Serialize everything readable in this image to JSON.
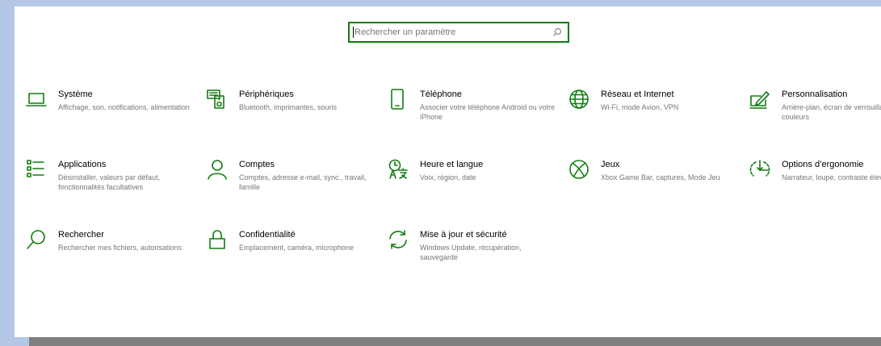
{
  "search": {
    "placeholder": "Rechercher un paramètre"
  },
  "accent": "#107c10",
  "tiles": [
    {
      "title": "Système",
      "desc": "Affichage, son, notifications, alimentation",
      "icon": "laptop-icon"
    },
    {
      "title": "Périphériques",
      "desc": "Bluetooth, imprimantes, souris",
      "icon": "keyboard-speaker-icon"
    },
    {
      "title": "Téléphone",
      "desc": "Associer votre téléphone Android ou votre iPhone",
      "icon": "phone-icon"
    },
    {
      "title": "Réseau et Internet",
      "desc": "Wi-Fi, mode Avion, VPN",
      "icon": "globe-icon"
    },
    {
      "title": "Personnalisation",
      "desc": "Arrière-plan, écran de verrouillage, couleurs",
      "icon": "pen-tablet-icon"
    },
    {
      "title": "Applications",
      "desc": "Désinstaller, valeurs par défaut, fonctionnalités facultatives",
      "icon": "app-list-icon"
    },
    {
      "title": "Comptes",
      "desc": "Comptes, adresse e-mail, sync., travail, famille",
      "icon": "person-icon"
    },
    {
      "title": "Heure et langue",
      "desc": "Voix, région, date",
      "icon": "clock-language-icon"
    },
    {
      "title": "Jeux",
      "desc": "Xbox Game Bar, captures, Mode Jeu",
      "icon": "xbox-icon"
    },
    {
      "title": "Options d’ergonomie",
      "desc": "Narrateur, loupe, contraste élevé",
      "icon": "ease-of-access-icon"
    },
    {
      "title": "Rechercher",
      "desc": "Rechercher mes fichiers, autorisations",
      "icon": "search-icon"
    },
    {
      "title": "Confidentialité",
      "desc": "Emplacement, caméra, microphone",
      "icon": "lock-icon"
    },
    {
      "title": "Mise à jour et sécurité",
      "desc": "Windows Update, récupération, sauvegarde",
      "icon": "sync-icon"
    }
  ]
}
